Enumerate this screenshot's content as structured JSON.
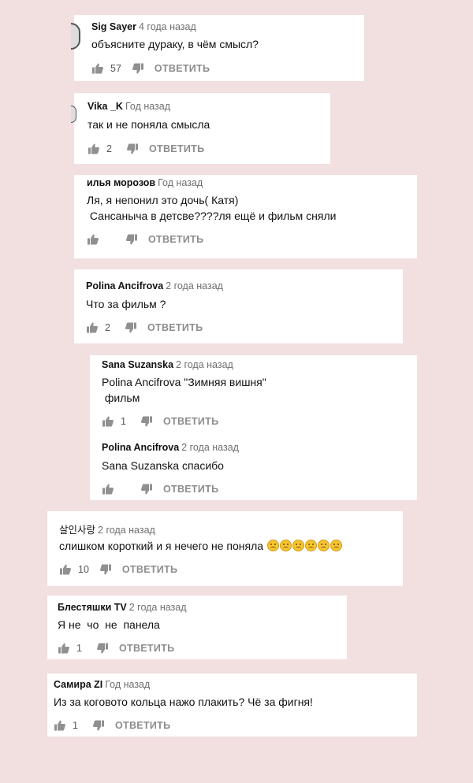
{
  "ui": {
    "reply_label": "ОТВЕТИТЬ",
    "like_icon": "thumbs-up-icon",
    "dislike_icon": "thumbs-down-icon",
    "background": "#f2dfe0"
  },
  "comments": [
    {
      "author": "Sig Sayer",
      "time": "4 года назад",
      "lines": [
        "объясните дураку, в чём смысл?"
      ],
      "likes": "57"
    },
    {
      "author": "Vika _K",
      "time": "Год назад",
      "lines": [
        "так и не поняла смысла"
      ],
      "likes": "2"
    },
    {
      "author": "илья морозов",
      "time": "Год назад",
      "lines": [
        "Ля, я непонил это дочь( Катя)",
        " Сансаныча в детсве????ля ещё и фильм сняли"
      ],
      "likes": ""
    },
    {
      "author": "Polina Ancifrova",
      "time": "2 года назад",
      "lines": [
        "Что за фильм ?"
      ],
      "likes": "2"
    },
    {
      "author": "Sana Suzanska",
      "time": "2 года назад",
      "lines": [
        "Polina Ancifrova \"Зимняя вишня\"",
        " фильм"
      ],
      "likes": "1"
    },
    {
      "author": "Polina Ancifrova",
      "time": "2 года назад",
      "lines": [
        "Sana Suzanska спасибо"
      ],
      "likes": ""
    },
    {
      "author": "살인사랑",
      "time": "2 года назад",
      "lines": [
        "слишком короткий и я нечего не поняла"
      ],
      "emoji_count": 6,
      "emoji_name": "confused-face-emoji",
      "likes": "10"
    },
    {
      "author": "Блестяшки TV",
      "time": "2 года назад",
      "lines": [
        "Я не  чо  не  панела"
      ],
      "likes": "1"
    },
    {
      "author": "Самира ZI",
      "time": "Год назад",
      "lines": [
        "Из за коговото кольца нажо плакить? Чё за фигня!"
      ],
      "likes": "1"
    }
  ]
}
